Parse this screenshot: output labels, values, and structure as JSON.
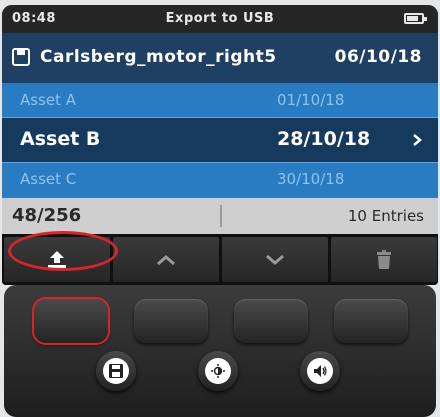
{
  "status": {
    "time": "08:48",
    "title": "Export to USB"
  },
  "file": {
    "name": "Carlsberg_motor_right5",
    "date": "06/10/18"
  },
  "assets": [
    {
      "name": "Asset A",
      "date": "01/10/18"
    },
    {
      "name": "Asset B",
      "date": "28/10/18"
    },
    {
      "name": "Asset C",
      "date": "30/10/18"
    }
  ],
  "footer": {
    "count": "48/256",
    "entries": "10 Entries"
  },
  "softkeys": [
    "export-usb-icon",
    "arrow-up-icon",
    "arrow-down-icon",
    "trash-icon"
  ],
  "hardkeys": [
    "save-icon",
    "brightness-icon",
    "volume-icon"
  ],
  "colors": {
    "header": "#1f3f63",
    "list": "#2a7cc2",
    "selected": "#153a5e",
    "highlight": "#d6262b"
  }
}
